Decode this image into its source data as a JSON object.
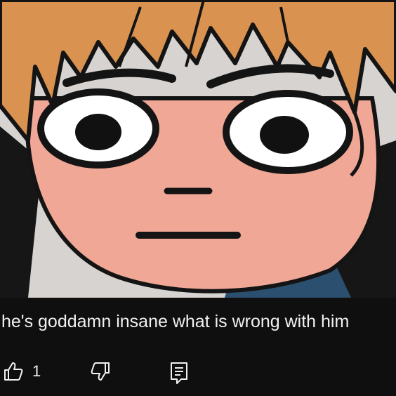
{
  "comment": {
    "text": "he's goddamn insane what is wrong with him",
    "like_count": "1"
  },
  "icons": {
    "like": "thumbs-up-icon",
    "dislike": "thumbs-down-icon",
    "reply": "reply-comment-icon"
  },
  "colors": {
    "bar_background": "#0f0f0f",
    "text": "#f1f1f1",
    "hair": "#d9924f",
    "skin": "#f0a795"
  }
}
